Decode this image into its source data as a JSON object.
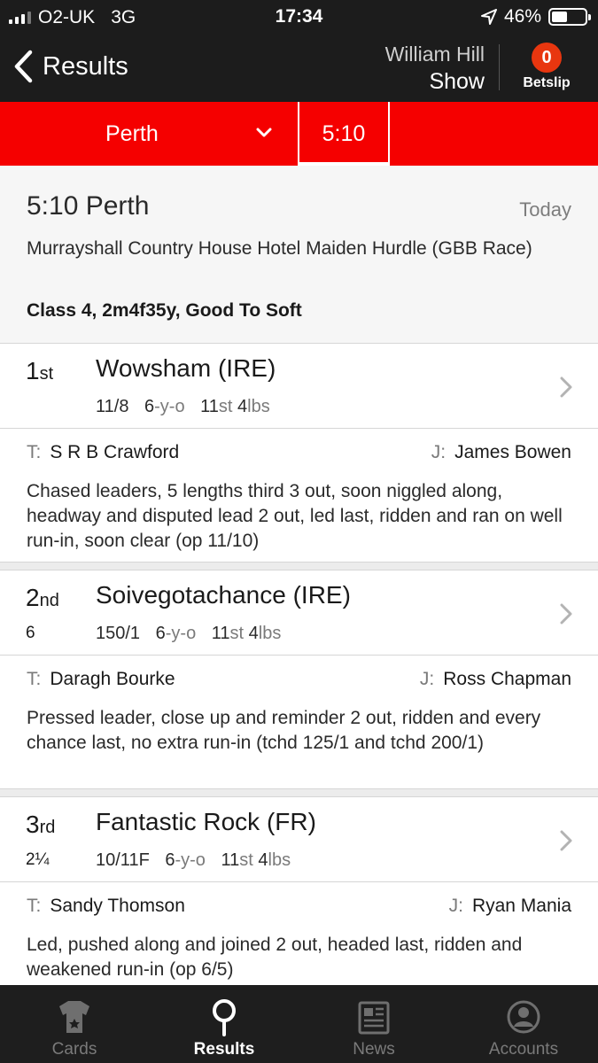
{
  "status_bar": {
    "carrier": "O2-UK",
    "network": "3G",
    "time": "17:34",
    "battery": "46%",
    "battery_level": 0.46
  },
  "nav": {
    "back_label": "Results",
    "brand": "William Hill",
    "show_label": "Show",
    "betslip_count": "0",
    "betslip_label": "Betslip"
  },
  "selector": {
    "course": "Perth",
    "time": "5:10"
  },
  "race": {
    "title": "5:10 Perth",
    "day": "Today",
    "name": "Murrayshall Country House Hotel Maiden Hurdle (GBB Race)",
    "class_info": "Class 4, 2m4f35y, Good To Soft"
  },
  "runners": [
    {
      "pos_num": "1",
      "pos_suffix": "st",
      "distance": "",
      "horse": "Wowsham (IRE)",
      "odds": "11/8",
      "age_num": "6",
      "age_unit": "-y-o",
      "weight_st": "11",
      "st_unit": "st",
      "weight_lbs": "4",
      "lbs_unit": "lbs",
      "trainer_key": "T:",
      "trainer": "S R B Crawford",
      "jockey_key": "J:",
      "jockey": "James Bowen",
      "comment": "Chased leaders, 5 lengths third 3 out, soon niggled along, headway and disputed lead 2 out, led last, ridden and ran on well run-in, soon clear (op 11/10)"
    },
    {
      "pos_num": "2",
      "pos_suffix": "nd",
      "distance": "6",
      "horse": "Soivegotachance (IRE)",
      "odds": "150/1",
      "age_num": "6",
      "age_unit": "-y-o",
      "weight_st": "11",
      "st_unit": "st",
      "weight_lbs": "4",
      "lbs_unit": "lbs",
      "trainer_key": "T:",
      "trainer": "Daragh Bourke",
      "jockey_key": "J:",
      "jockey": "Ross Chapman",
      "comment": "Pressed leader, close up and reminder 2 out, ridden and every chance last, no extra run-in (tchd 125/1 and tchd 200/1)"
    },
    {
      "pos_num": "3",
      "pos_suffix": "rd",
      "distance": "2¼",
      "horse": "Fantastic Rock (FR)",
      "odds": "10/11F",
      "age_num": "6",
      "age_unit": "-y-o",
      "weight_st": "11",
      "st_unit": "st",
      "weight_lbs": "4",
      "lbs_unit": "lbs",
      "trainer_key": "T:",
      "trainer": "Sandy Thomson",
      "jockey_key": "J:",
      "jockey": "Ryan Mania",
      "comment": "Led, pushed along and joined 2 out, headed last, ridden and weakened run-in (op 6/5)"
    }
  ],
  "tabs": [
    {
      "label": "Cards",
      "icon": "jockey-silks-icon"
    },
    {
      "label": "Results",
      "icon": "magnifier-icon"
    },
    {
      "label": "News",
      "icon": "newspaper-icon"
    },
    {
      "label": "Accounts",
      "icon": "account-icon"
    }
  ],
  "colors": {
    "accent_red": "#f50000",
    "dark_bar": "#1c1c1c",
    "badge_orange": "#e8360f"
  }
}
